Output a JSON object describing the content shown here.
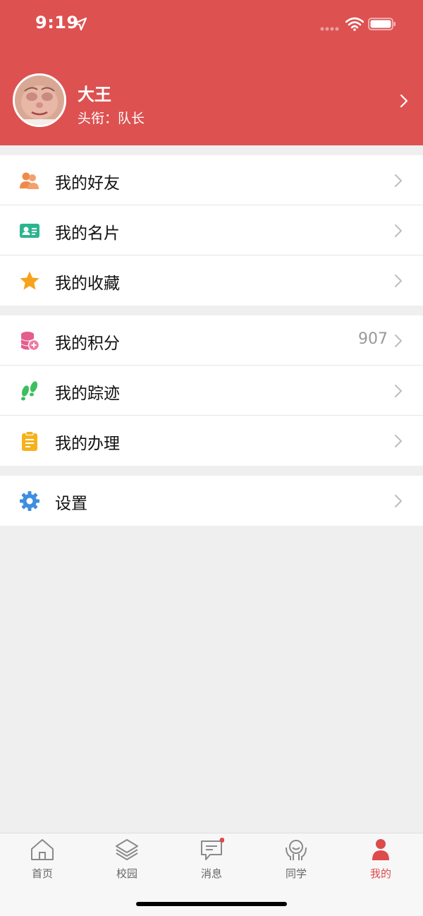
{
  "status_bar": {
    "time": "9:19"
  },
  "profile": {
    "name": "大王",
    "title_label": "头衔：",
    "title_value": "队长"
  },
  "menu_groups": [
    [
      {
        "label": "我的好友",
        "icon": "friends-icon",
        "color": "#f08a4b"
      },
      {
        "label": "我的名片",
        "icon": "card-icon",
        "color": "#2bb58f"
      },
      {
        "label": "我的收藏",
        "icon": "star-icon",
        "color": "#f7a21b"
      }
    ],
    [
      {
        "label": "我的积分",
        "icon": "points-icon",
        "color": "#e35d8d",
        "value": "907"
      },
      {
        "label": "我的踪迹",
        "icon": "footprints-icon",
        "color": "#3cbf5e"
      },
      {
        "label": "我的办理",
        "icon": "clipboard-icon",
        "color": "#f5b21c"
      }
    ],
    [
      {
        "label": "设置",
        "icon": "gear-icon",
        "color": "#3f8ee0"
      }
    ]
  ],
  "tabs": [
    {
      "label": "首页",
      "icon": "home-icon"
    },
    {
      "label": "校园",
      "icon": "layers-icon"
    },
    {
      "label": "消息",
      "icon": "message-icon",
      "badge": true
    },
    {
      "label": "同学",
      "icon": "classmates-icon"
    },
    {
      "label": "我的",
      "icon": "person-icon",
      "active": true
    }
  ],
  "colors": {
    "header": "#dd5151",
    "active_tab": "#dd4b4b",
    "background": "#efefef"
  }
}
